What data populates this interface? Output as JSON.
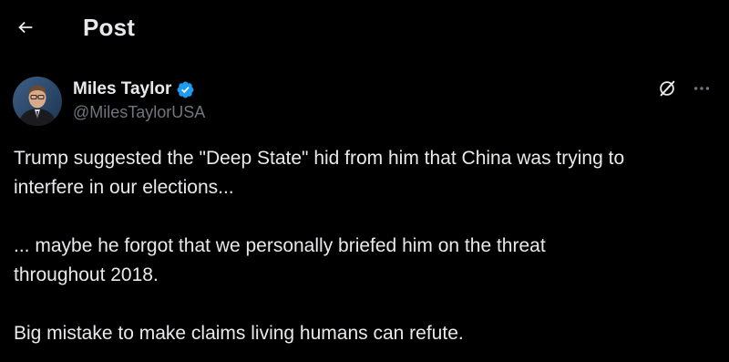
{
  "header": {
    "title": "Post",
    "back_icon": "arrow-left-icon"
  },
  "post": {
    "author": {
      "display_name": "Miles Taylor",
      "handle": "@MilesTaylorUSA",
      "verified": true,
      "verified_color": "#1d9bf0"
    },
    "actions": {
      "grok_icon": "grok-icon",
      "more_icon": "more-horizontal-icon"
    },
    "paragraphs": [
      {
        "lines": [
          "Trump suggested the \"Deep State\" hid from him that China was trying to",
          "interfere in our elections..."
        ]
      },
      {
        "lines": [
          "... maybe he forgot that we personally briefed him on the threat",
          "throughout 2018."
        ]
      },
      {
        "lines": [
          "Big mistake to make claims living humans can refute."
        ]
      }
    ]
  }
}
